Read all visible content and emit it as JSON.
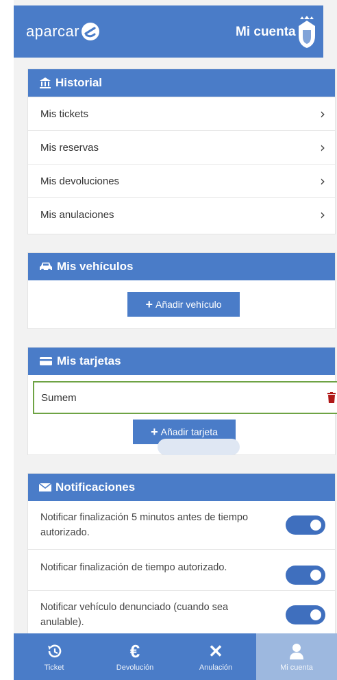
{
  "header": {
    "logo_text": "aparcar",
    "title": "Mi cuenta"
  },
  "historial": {
    "title": "Historial",
    "items": [
      {
        "label": "Mis tickets"
      },
      {
        "label": "Mis reservas"
      },
      {
        "label": "Mis devoluciones"
      },
      {
        "label": "Mis anulaciones"
      }
    ]
  },
  "vehiculos": {
    "title": "Mis vehículos",
    "add_label": "Añadir vehículo"
  },
  "tarjetas": {
    "title": "Mis tarjetas",
    "card_name": "Sumem",
    "add_label": "Añadir tarjeta"
  },
  "notificaciones": {
    "title": "Notificaciones",
    "items": [
      {
        "label": "Notificar finalización 5 minutos antes de tiempo autorizado.",
        "enabled": true
      },
      {
        "label": "Notificar finalización de tiempo autorizado.",
        "enabled": true
      },
      {
        "label": "Notificar vehículo denunciado (cuando sea anulable).",
        "enabled": true
      }
    ]
  },
  "tabbar": {
    "tabs": [
      {
        "label": "Ticket",
        "icon": "history-icon"
      },
      {
        "label": "Devolución",
        "icon": "euro-icon"
      },
      {
        "label": "Anulación",
        "icon": "close-icon"
      },
      {
        "label": "Mi cuenta",
        "icon": "user-icon",
        "active": true
      }
    ]
  },
  "colors": {
    "primary": "#4a7cc8",
    "highlight": "#6ea344",
    "delete": "#b01818",
    "active_tab": "#9db8df"
  }
}
